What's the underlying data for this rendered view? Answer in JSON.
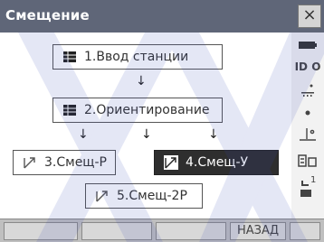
{
  "window": {
    "title": "Смещение",
    "close_glyph": "×"
  },
  "nodes": [
    {
      "label": "1.Ввод станции",
      "icon": "grid-icon"
    },
    {
      "label": "2.Ориентирование",
      "icon": "grid-icon"
    },
    {
      "label": "3.Смещ-Р",
      "icon": "offset-icon"
    },
    {
      "label": "4.Смещ-У",
      "icon": "offset-icon",
      "selected": true
    },
    {
      "label": "5.Смещ-2Р",
      "icon": "offset-icon"
    }
  ],
  "sidebar": {
    "top_icon": "battery-icon",
    "mode_text": "ID  O",
    "icons": [
      "tilt-icon",
      "dot-icon",
      "level-icon",
      "memory-icon",
      "signal-icon"
    ],
    "signal_value": "1"
  },
  "softkeys": [
    "",
    "",
    "",
    "",
    "НАЗАД",
    ""
  ],
  "colors": {
    "title_bar": "#5f6678",
    "selected_bg": "#2e2e2e",
    "softkey_bar": "#bfbfbf"
  }
}
